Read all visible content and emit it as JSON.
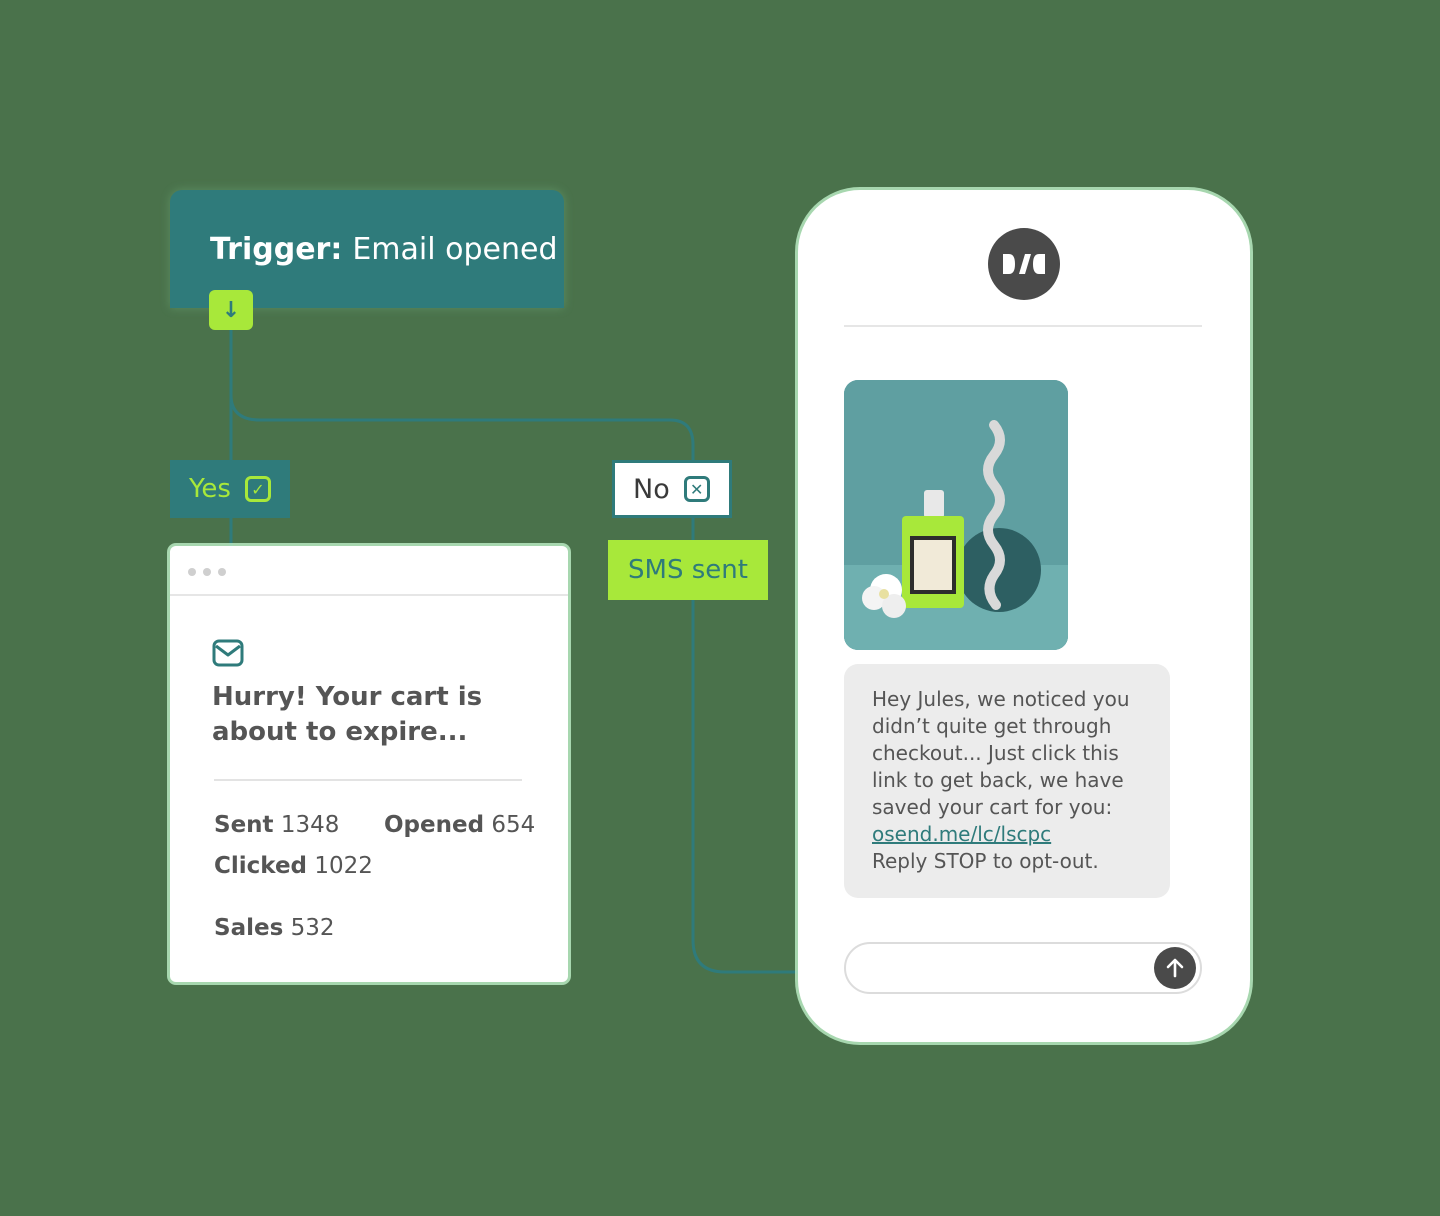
{
  "trigger": {
    "label": "Trigger:",
    "event": "Email opened",
    "arrow_icon": "arrow-down-icon"
  },
  "branches": {
    "yes_label": "Yes",
    "yes_icon": "check-square-icon",
    "no_label": "No",
    "no_icon": "x-square-icon",
    "sms_label": "SMS sent"
  },
  "email_card": {
    "icon": "mail-icon",
    "title": "Hurry! Your cart is about to expire...",
    "stats": {
      "sent_label": "Sent",
      "sent_value": "1348",
      "opened_label": "Opened",
      "opened_value": "654",
      "clicked_label": "Clicked",
      "clicked_value": "1022",
      "sales_label": "Sales",
      "sales_value": "532"
    }
  },
  "phone": {
    "logo_icon": "brand-logo-icon",
    "message_text": "Hey Jules, we noticed you didn’t quite get through checkout... Just click this link to get back, we have saved your cart for you:",
    "message_link": "osend.me/lc/lscpc",
    "message_footer": "Reply STOP to opt-out.",
    "input_value": "",
    "send_icon": "arrow-up-icon"
  },
  "colors": {
    "background": "#4a724b",
    "teal": "#2f7b7b",
    "lime": "#a8e83a",
    "white": "#ffffff",
    "text_gray": "#555555"
  }
}
